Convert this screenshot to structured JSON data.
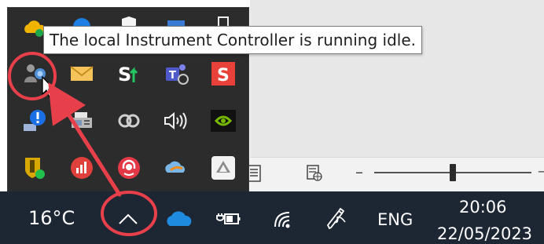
{
  "tooltip": {
    "text": "The local Instrument Controller is running idle."
  },
  "taskbar": {
    "temperature": "16°C",
    "language": "ENG",
    "time": "20:06",
    "date": "22/05/2023"
  },
  "tray_icons": [
    "instrument-controller-icon",
    "mail-icon",
    "speedtest-icon",
    "teams-icon",
    "sumatra-s-icon",
    "network-alert-icon",
    "fax-printer-icon",
    "creative-cloud-icon",
    "volume-icon",
    "nvidia-icon",
    "shield-tool-icon",
    "analytics-app-icon",
    "support-headset-icon",
    "cloud-sync-icon",
    "google-drive-icon"
  ],
  "colors": {
    "taskbar": "#1d2633",
    "flyout": "#2c2c2c",
    "annotation": "#e8404a"
  },
  "zoom_slider": {
    "level": 0.5
  }
}
